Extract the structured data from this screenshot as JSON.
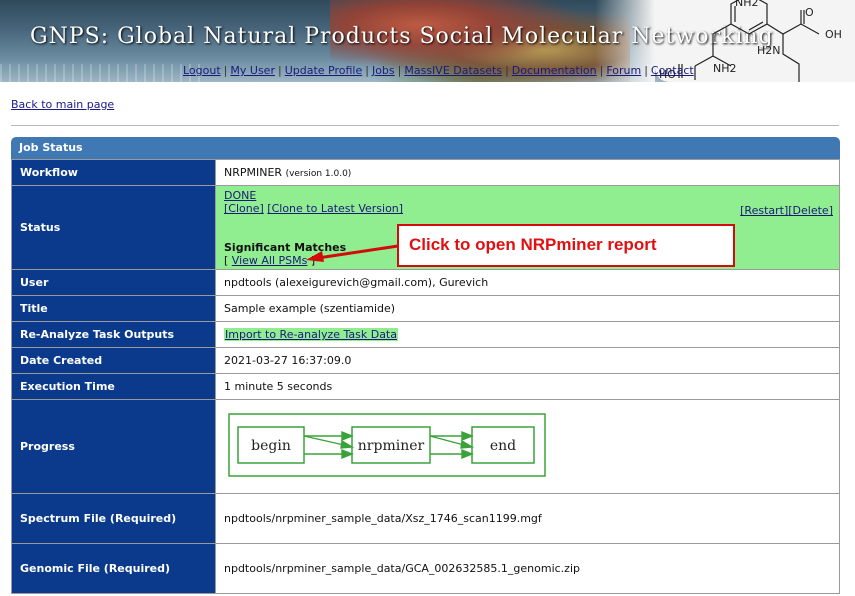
{
  "banner": {
    "title": "GNPS: Global Natural Products Social Molecular Networking",
    "molecule_labels": [
      "NH2",
      "O",
      "OH",
      "H2N",
      "HO",
      "NH2"
    ]
  },
  "nav": {
    "links": [
      "Logout",
      "My User",
      "Update Profile",
      "Jobs",
      "MassIVE Datasets",
      "Documentation",
      "Forum",
      "Contact"
    ],
    "separator": "|"
  },
  "back_link": "Back to main page",
  "job": {
    "header": "Job Status",
    "workflow": {
      "label": "Workflow",
      "name": "NRPMINER",
      "version": "(version 1.0.0)"
    },
    "status": {
      "label": "Status",
      "state": "DONE",
      "clone": "[Clone]",
      "clone_latest": "[Clone to Latest Version]",
      "restart": "[Restart]",
      "delete": "[Delete]",
      "significant": "Significant Matches",
      "view_prefix": "[ ",
      "view_all": "View All PSMs",
      "view_suffix": " ]"
    },
    "user": {
      "label": "User",
      "value": "npdtools (alexeigurevich@gmail.com), Gurevich"
    },
    "title": {
      "label": "Title",
      "value": "Sample example (szentiamide)"
    },
    "reanalyze": {
      "label": "Re-Analyze Task Outputs",
      "value": "Import to Re-analyze Task Data"
    },
    "date_created": {
      "label": "Date Created",
      "value": "2021-03-27 16:37:09.0"
    },
    "execution_time": {
      "label": "Execution Time",
      "value": "1 minute 5 seconds"
    },
    "progress": {
      "label": "Progress",
      "steps": [
        "begin",
        "nrpminer",
        "end"
      ]
    },
    "spectrum_file": {
      "label": "Spectrum File (Required)",
      "value": "npdtools/nrpminer_sample_data/Xsz_1746_scan1199.mgf"
    },
    "genomic_file": {
      "label": "Genomic File (Required)",
      "value": "npdtools/nrpminer_sample_data/GCA_002632585.1_genomic.zip"
    }
  },
  "callout": "Click to open NRPminer report",
  "colors": {
    "key_bg": "#0b3a8c",
    "header_bg": "#3f78b3",
    "done_bg": "#90ee90",
    "callout_red": "#d40b0b",
    "flow_green": "#3aa23a"
  }
}
